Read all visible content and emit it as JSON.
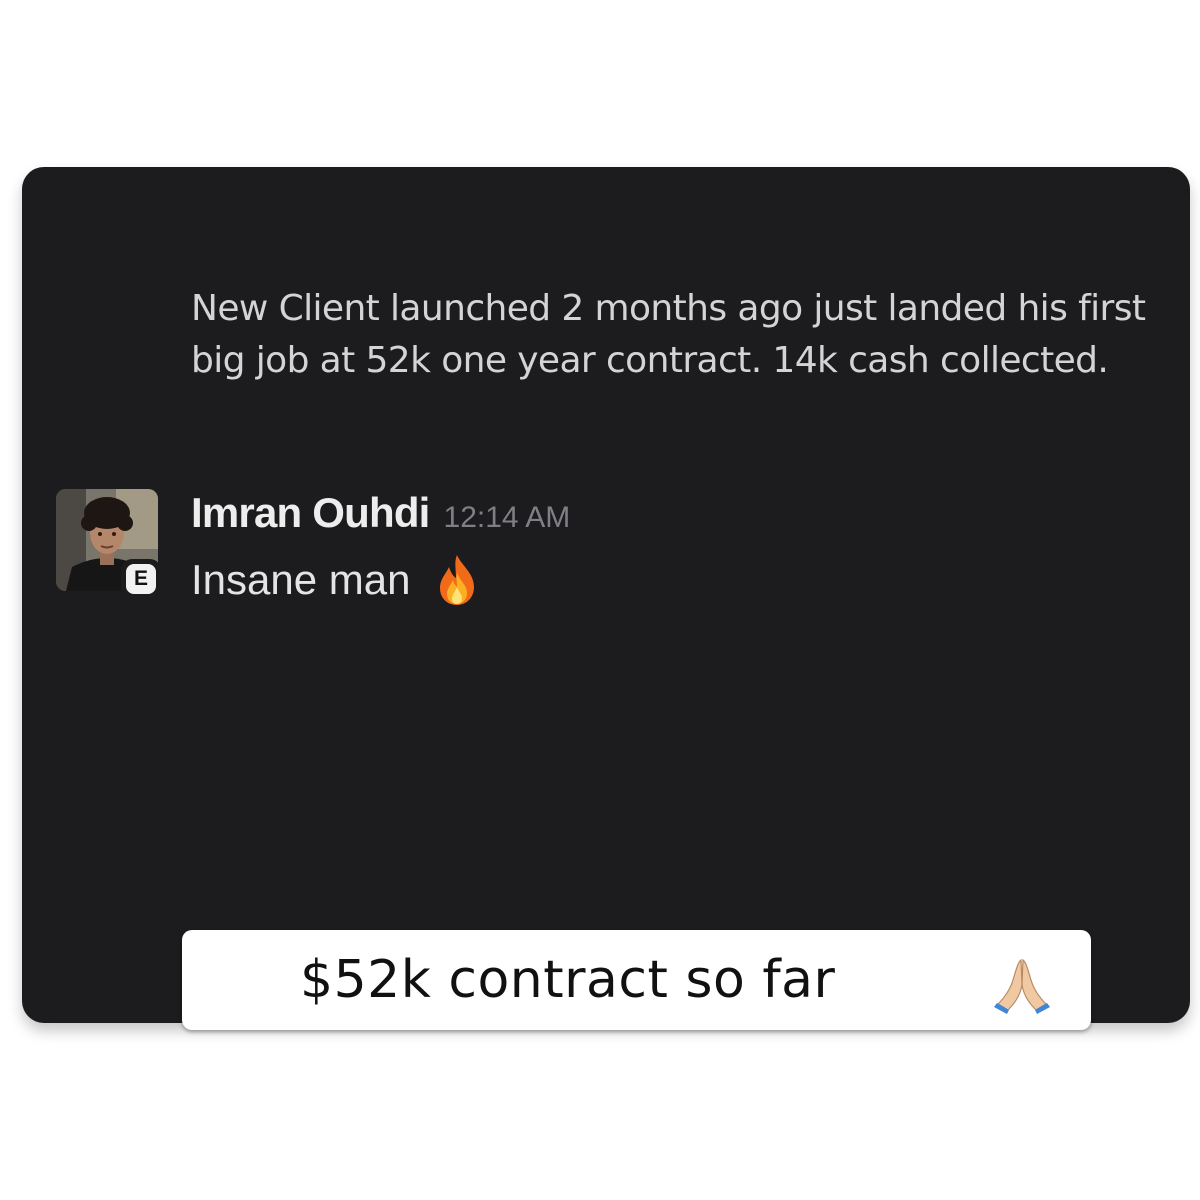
{
  "previous_message": {
    "text": "New  Client launched  2 months ago just landed his first big job at 52k one year contract. 14k cash collected."
  },
  "reply": {
    "author": "Imran Ouhdi",
    "time": "12:14 AM",
    "text": "Insane man",
    "badge": "E",
    "emoji_icon": "fire-icon"
  },
  "caption": {
    "text": "$52k contract so far",
    "emoji_icon": "praying-hands-icon"
  },
  "colors": {
    "card_background": "#1c1c1e",
    "caption_background": "#ffffff"
  }
}
